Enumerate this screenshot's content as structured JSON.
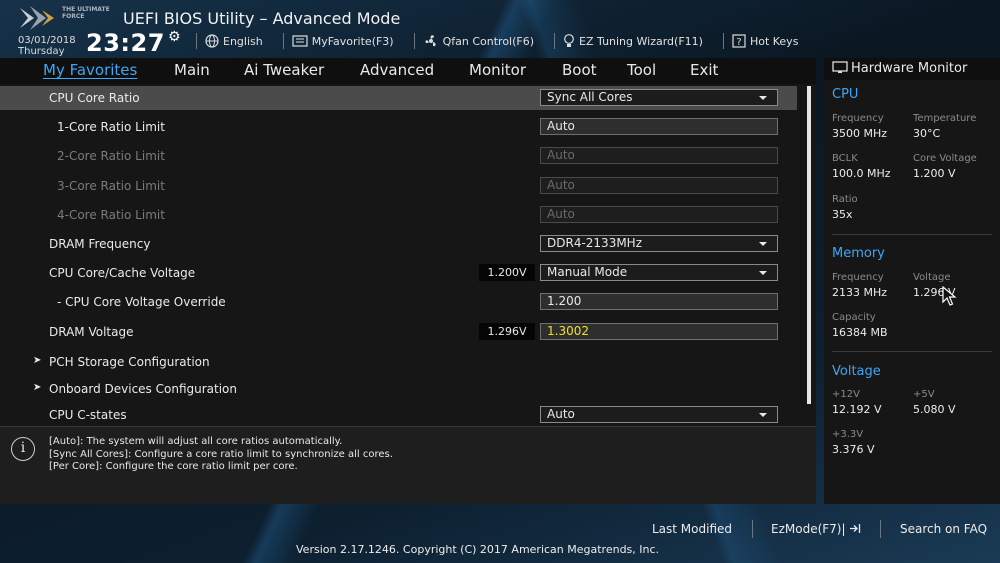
{
  "window": {
    "title": "UEFI BIOS Utility – Advanced Mode",
    "logo_text": "THE ULTIMATE FORCE"
  },
  "datetime": {
    "date": "03/01/2018",
    "weekday": "Thursday",
    "time": "23:27"
  },
  "toolbar": [
    {
      "label": "English",
      "icon": "globe-icon"
    },
    {
      "label": "MyFavorite(F3)",
      "icon": "favorite-icon"
    },
    {
      "label": "Qfan Control(F6)",
      "icon": "fan-icon"
    },
    {
      "label": "EZ Tuning Wizard(F11)",
      "icon": "bulb-icon"
    },
    {
      "label": "Hot Keys",
      "icon": "question-icon"
    }
  ],
  "tabs": [
    "My Favorites",
    "Main",
    "Ai Tweaker",
    "Advanced",
    "Monitor",
    "Boot",
    "Tool",
    "Exit"
  ],
  "active_tab": "My Favorites",
  "rows": [
    {
      "label": "CPU Core Ratio",
      "value": "Sync All Cores",
      "type": "dropdown",
      "selected": true
    },
    {
      "label": "1-Core Ratio Limit",
      "value": "Auto",
      "type": "input"
    },
    {
      "label": "2-Core Ratio Limit",
      "value": "Auto",
      "type": "input",
      "disabled": true
    },
    {
      "label": "3-Core Ratio Limit",
      "value": "Auto",
      "type": "input",
      "disabled": true
    },
    {
      "label": "4-Core Ratio Limit",
      "value": "Auto",
      "type": "input",
      "disabled": true
    },
    {
      "label": "DRAM Frequency",
      "value": "DDR4-2133MHz",
      "type": "dropdown"
    },
    {
      "label": "CPU Core/Cache Voltage",
      "current": "1.200V",
      "value": "Manual Mode",
      "type": "dropdown"
    },
    {
      "label": "- CPU Core Voltage Override",
      "value": "1.200",
      "type": "input"
    },
    {
      "label": "DRAM Voltage",
      "current": "1.296V",
      "value": "1.3002",
      "type": "input",
      "highlight": "#f0e020"
    },
    {
      "label": "PCH Storage Configuration",
      "type": "submenu"
    },
    {
      "label": "Onboard Devices Configuration",
      "type": "submenu"
    },
    {
      "label": "CPU C-states",
      "value": "Auto",
      "type": "dropdown"
    }
  ],
  "help_lines": [
    "[Auto]: The system will adjust all core ratios automatically.",
    "[Sync All Cores]: Configure a core ratio limit to synchronize all cores.",
    "[Per Core]: Configure the core ratio limit per core."
  ],
  "hardware_monitor": {
    "title": "Hardware Monitor",
    "cpu": {
      "heading": "CPU",
      "frequency_label": "Frequency",
      "frequency": "3500 MHz",
      "temperature_label": "Temperature",
      "temperature": "30°C",
      "bclk_label": "BCLK",
      "bclk": "100.0 MHz",
      "core_voltage_label": "Core Voltage",
      "core_voltage": "1.200 V",
      "ratio_label": "Ratio",
      "ratio": "35x"
    },
    "memory": {
      "heading": "Memory",
      "frequency_label": "Frequency",
      "frequency": "2133 MHz",
      "voltage_label": "Voltage",
      "voltage": "1.296 V",
      "capacity_label": "Capacity",
      "capacity": "16384 MB"
    },
    "voltage": {
      "heading": "Voltage",
      "v12_label": "+12V",
      "v12": "12.192 V",
      "v5_label": "+5V",
      "v5": "5.080 V",
      "v33_label": "+3.3V",
      "v33": "3.376 V"
    }
  },
  "footer": {
    "last_modified": "Last Modified",
    "ezmode": "EzMode(F7)|",
    "search_faq": "Search on FAQ",
    "copyright": "Version 2.17.1246. Copyright (C) 2017 American Megatrends, Inc."
  },
  "colors": {
    "accent": "#3ea6f5",
    "highlight_value": "#f0e020",
    "panel": "#161616",
    "selected_row": "#4b4b4b"
  }
}
